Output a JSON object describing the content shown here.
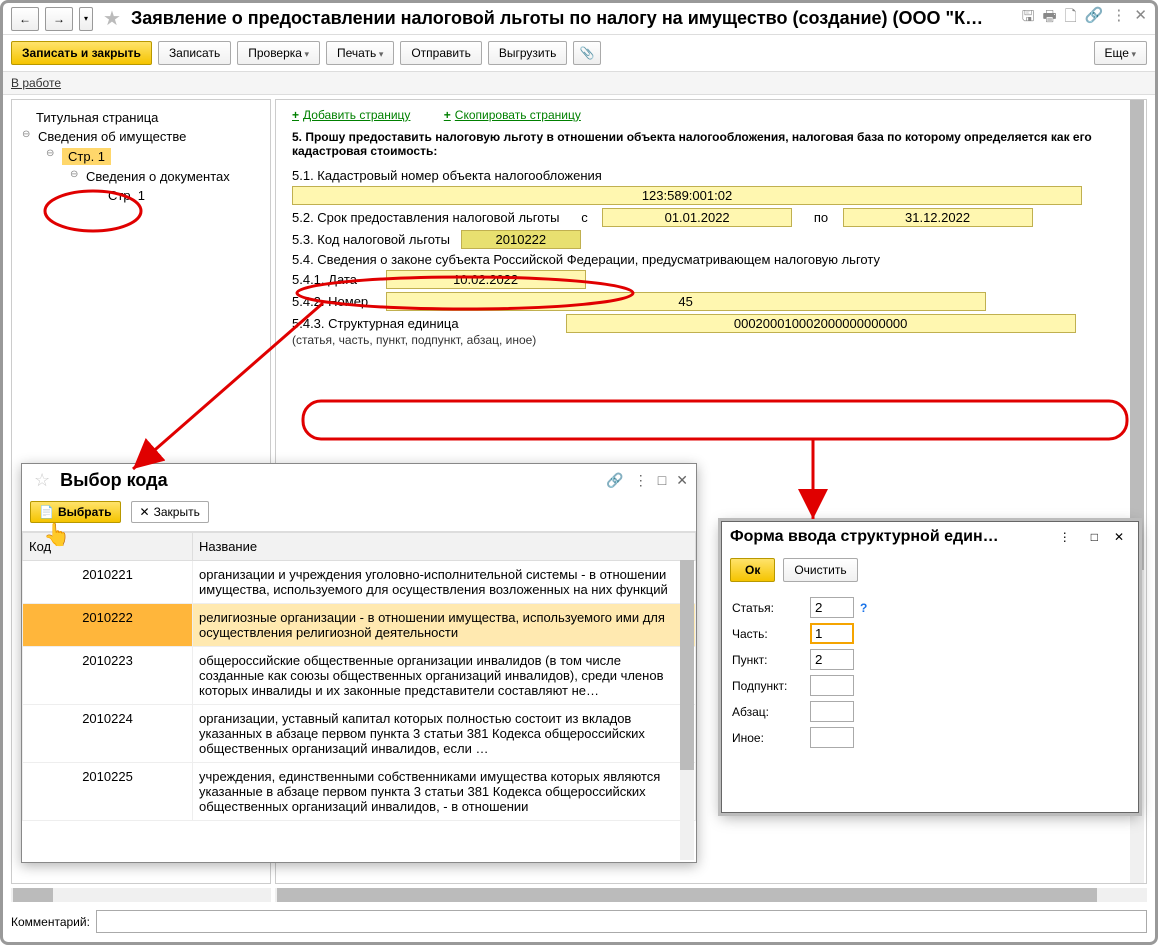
{
  "window": {
    "title": "Заявление о предоставлении налоговой льготы по налогу на имущество (создание) (ООО \"К…"
  },
  "toolbar": {
    "save_close": "Записать и закрыть",
    "save": "Записать",
    "check": "Проверка",
    "print": "Печать",
    "send": "Отправить",
    "export": "Выгрузить",
    "more": "Еще"
  },
  "status": {
    "text": "В работе"
  },
  "tree": {
    "title_page": "Титульная страница",
    "property_info": "Сведения об имуществе",
    "page1": "Стр. 1",
    "docs_info": "Сведения о документах",
    "docs_page1": "Стр. 1"
  },
  "page_actions": {
    "add_page": "Добавить страницу",
    "copy_page": "Скопировать страницу"
  },
  "form": {
    "heading": "5. Прошу предоставить налоговую льготу в отношении объекта налогообложения, налоговая база по которому определяется как его кадастровая стоимость:",
    "f51_label": "5.1. Кадастровый номер объекта налогообложения",
    "f51_value": "123:589:001:02",
    "f52_label": "5.2. Срок предоставления налоговой льготы",
    "f52_from_lbl": "с",
    "f52_from": "01.01.2022",
    "f52_to_lbl": "по",
    "f52_to": "31.12.2022",
    "f53_label": "5.3. Код налоговой льготы",
    "f53_value": "2010222",
    "f54_label": "5.4. Сведения о законе субъекта Российской Федерации, предусматривающем налоговую льготу",
    "f541_label": "5.4.1. Дата",
    "f541_value": "10.02.2022",
    "f542_label": "5.4.2. Номер",
    "f542_value": "45",
    "f543_label": "5.4.3. Структурная единица",
    "f543_hint": "(статья, часть, пункт, подпункт, абзац, иное)",
    "f543_value": "000200010002000000000000"
  },
  "code_popup": {
    "title": "Выбор кода",
    "select": "Выбрать",
    "close": "Закрыть",
    "col_code": "Код",
    "col_name": "Название",
    "rows": [
      {
        "code": "2010221",
        "name": "организации и учреждения уголовно-исполнительной системы - в отношении имущества, используемого для осуществления возложенных на них функций"
      },
      {
        "code": "2010222",
        "name": "религиозные организации - в отношении имущества, используемого ими для осуществления религиозной деятельности"
      },
      {
        "code": "2010223",
        "name": "общероссийские общественные организации инвалидов (в том числе созданные как союзы общественных организаций инвалидов), среди членов которых инвалиды и их законные представители составляют не…"
      },
      {
        "code": "2010224",
        "name": "организации, уставный капитал которых полностью состоит из вкладов указанных в абзаце первом пункта 3 статьи 381 Кодекса общероссийских общественных организаций инвалидов, если …"
      },
      {
        "code": "2010225",
        "name": "учреждения, единственными собственниками имущества которых являются указанные в абзаце первом пункта 3 статьи 381 Кодекса общероссийских общественных организаций инвалидов, - в отношении"
      }
    ]
  },
  "struct_popup": {
    "title": "Форма ввода структурной един…",
    "ok": "Ок",
    "clear": "Очистить",
    "l_article": "Статья:",
    "v_article": "2",
    "l_part": "Часть:",
    "v_part": "1",
    "l_point": "Пункт:",
    "v_point": "2",
    "l_subpoint": "Подпункт:",
    "v_subpoint": "",
    "l_para": "Абзац:",
    "v_para": "",
    "l_other": "Иное:",
    "v_other": ""
  },
  "comment": {
    "label": "Комментарий:"
  }
}
